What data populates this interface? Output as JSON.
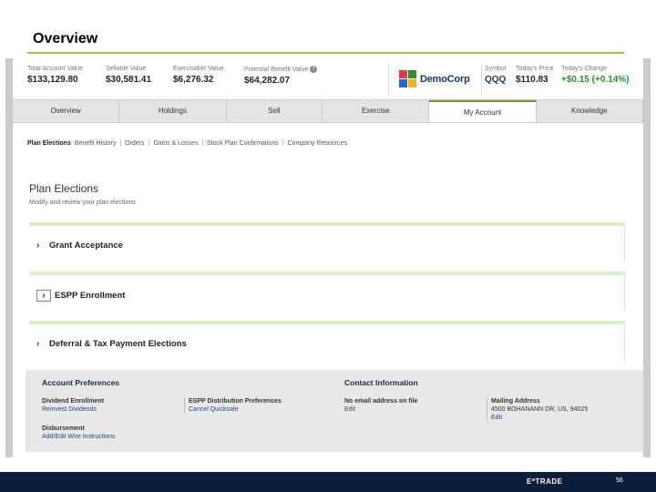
{
  "slide": {
    "title": "Overview"
  },
  "stats": [
    {
      "label": "Total Account Value",
      "value": "$133,129.80"
    },
    {
      "label": "Sellable Value",
      "value": "$30,581.41"
    },
    {
      "label": "Exercisable Value",
      "value": "$6,276.32"
    },
    {
      "label": "Potential Benefit Value",
      "value": "$64,282.07"
    }
  ],
  "logo": {
    "text": "DemoCorp"
  },
  "quote": {
    "symbol_label": "Symbol",
    "symbol": "QQQ",
    "price_label": "Today's Price",
    "price": "$110.83",
    "change_label": "Today's Change",
    "change": "+$0.15 (+0.14%)"
  },
  "tabs": [
    "Overview",
    "Holdings",
    "Sell",
    "Exercise",
    "My Account",
    "Knowledge"
  ],
  "subnav": [
    "Plan Elections",
    "Benefit History",
    "Orders",
    "Gains & Losses",
    "Stock Plan Confirmations",
    "Company Resources"
  ],
  "page": {
    "heading": "Plan Elections",
    "subtitle": "Modify and review your plan elections"
  },
  "panels": [
    "Grant Acceptance",
    "ESPP Enrollment",
    "Deferral & Tax Payment Elections"
  ],
  "account_prefs": {
    "heading": "Account Preferences",
    "dividend_label": "Dividend Enrollment",
    "dividend_link": "Reinvest Dividends",
    "espp_label": "ESPP Distribution Preferences",
    "espp_link": "Cancel Quicksale",
    "disb_label": "Disbursement",
    "disb_link": "Add/Edit Wire Instructions"
  },
  "contact": {
    "heading": "Contact Information",
    "email_label": "No email address on file",
    "email_link": "Edit",
    "mail_label": "Mailing Address",
    "mail_value": "4500 BOHANANN DR, US, 94025",
    "mail_link": "Edit"
  },
  "footer": {
    "brand": "E*TRADE",
    "page_number": "56"
  },
  "colors": {
    "accent_green": "#9bc53d",
    "navy": "#0c1e3c",
    "link_blue": "#1a4a88",
    "gain_green": "#2e8b2e"
  }
}
